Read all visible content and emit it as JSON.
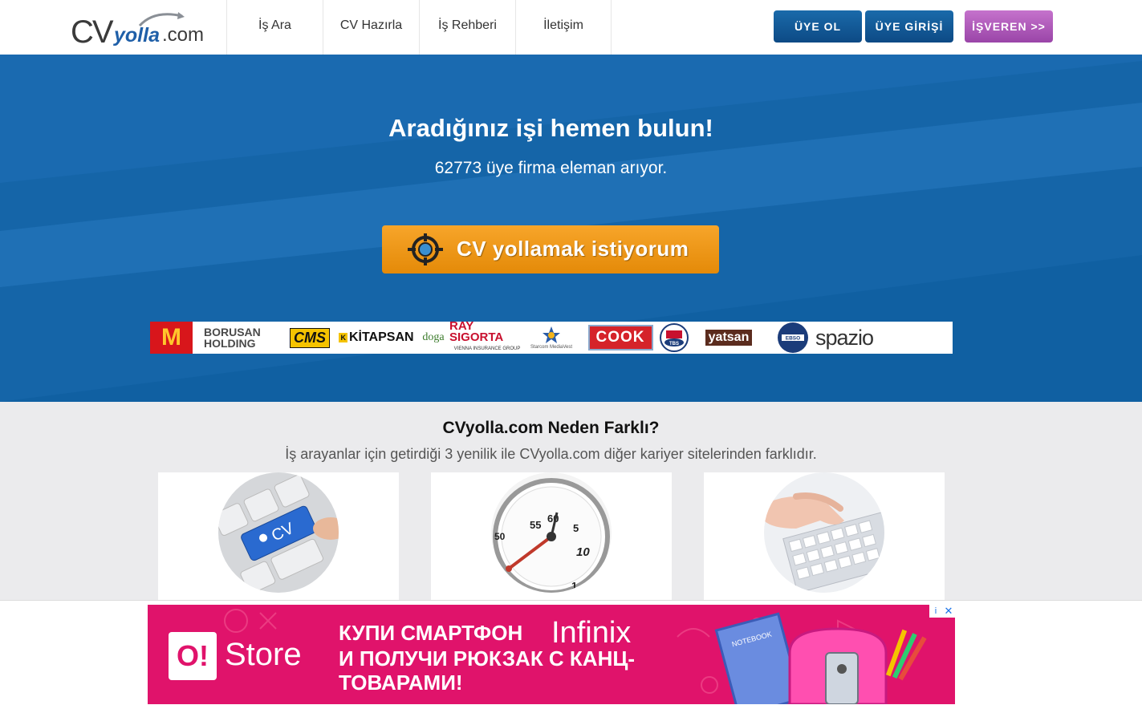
{
  "header": {
    "logo": {
      "cv": "CV",
      "yolla": "yolla",
      "com": ".com"
    },
    "nav": [
      "İş Ara",
      "CV Hazırla",
      "İş Rehberi",
      "İletişim"
    ],
    "buttons": {
      "register": "ÜYE OL",
      "login": "ÜYE GİRİŞİ",
      "employer": "İŞVEREN >>"
    }
  },
  "hero": {
    "title": "Aradığınız işi hemen bulun!",
    "subtitle": "62773 üye firma eleman arıyor.",
    "cta_label": "CV yollamak istiyorum",
    "brands": {
      "mcdonalds": "M",
      "borusan_line1": "BORUSAN",
      "borusan_line2": "HOLDING",
      "cms": "CMS",
      "kitapsan_k": "K",
      "kitapsan": "KİTAPSAN",
      "doga": "doga",
      "ray": "RAY SIGORTA",
      "ray_small": "VIENNA INSURANCE GROUP",
      "starcom": "Starcom MediaVest",
      "cook": "COOK",
      "tbs": "TBS",
      "yatsan": "yatsan",
      "ebso": "EBSO",
      "spazio": "spazio"
    }
  },
  "features": {
    "title": "CVyolla.com Neden Farklı?",
    "subtitle": "İş arayanlar için getirdiği 3 yenilik ile CVyolla.com diğer kariyer sitelerinden farklıdır.",
    "key_label": "CV",
    "clock_labels": [
      "55",
      "60",
      "5",
      "10",
      "50",
      "1"
    ]
  },
  "ad": {
    "logo": "O!",
    "store": "Store",
    "text": "КУПИ СМАРТФОН",
    "brand": "Infinix",
    "text2": "И ПОЛУЧИ РЮКЗАК С КАНЦ-ТОВАРАМИ!",
    "info": "i",
    "close": "✕",
    "notebook": "NOTEBOOK"
  },
  "colors": {
    "primary_blue": "#1565a8",
    "cta_orange": "#f39a17",
    "employer_purple": "#b15bbd",
    "ad_pink": "#e0136b"
  }
}
